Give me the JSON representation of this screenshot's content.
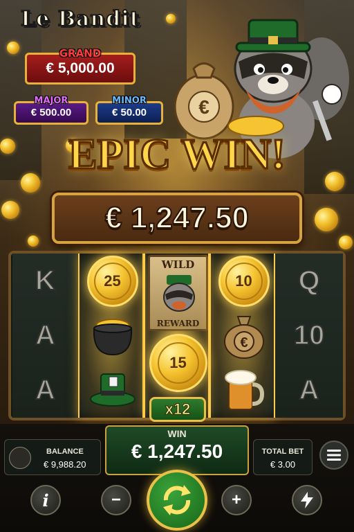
{
  "game": {
    "logo_text": "Le Bandit"
  },
  "jackpots": {
    "grand": {
      "label": "GRAND",
      "value": "€ 5,000.00"
    },
    "major": {
      "label": "MAJOR",
      "value": "€ 500.00"
    },
    "minor": {
      "label": "MINOR",
      "value": "€ 50.00"
    }
  },
  "win_banner": {
    "title": "EPIC WIN!",
    "amount": "€ 1,247.50"
  },
  "reels": {
    "reel1": [
      "K",
      "A",
      "A"
    ],
    "reel2": {
      "coin_top": "25",
      "middle_icon": "pot-of-gold-icon",
      "bottom_icon": "green-hat-icon"
    },
    "reel3": {
      "wild_top": "WILD",
      "wild_bottom": "REWARD",
      "coin": "15",
      "multiplier": "x12"
    },
    "reel4": {
      "coin_top": "10",
      "middle_icon": "money-bag-icon",
      "bottom_icon": "beer-mug-icon"
    },
    "reel5": [
      "Q",
      "10",
      "A"
    ]
  },
  "bottom_bar": {
    "balance_label": "BALANCE",
    "balance_value": "€ 9,988.20",
    "win_label": "WIN",
    "win_value": "€ 1,247.50",
    "total_bet_label": "TOTAL BET",
    "total_bet_value": "€ 3.00",
    "info_label": "i",
    "minus_label": "−",
    "plus_label": "+"
  },
  "colors": {
    "gold": "#ffd54a",
    "win_green": "#1f4a27",
    "grand_red": "#a51d1d",
    "major_purple": "#5a1b86",
    "minor_blue": "#1d3c8a"
  }
}
